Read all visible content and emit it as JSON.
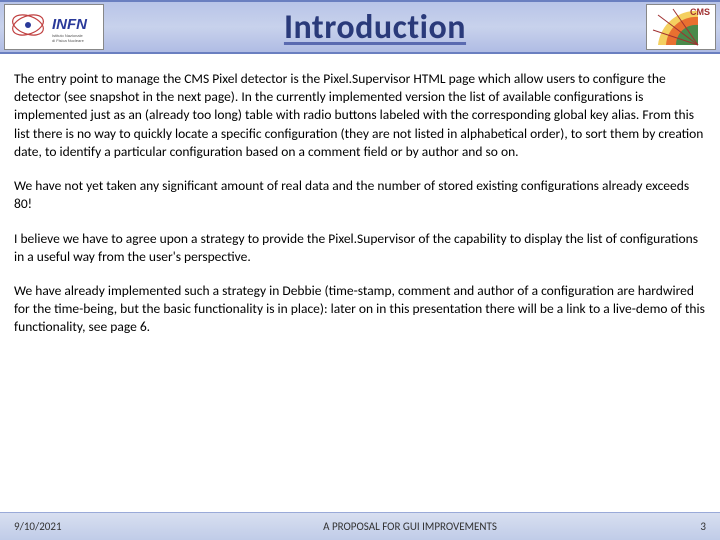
{
  "header": {
    "title": "Introduction",
    "logo_left_text_main": "INFN",
    "logo_left_text_sub": "Istituto Nazionale di Fisica Nucleare",
    "logo_right_text": "CMS"
  },
  "body": {
    "p1": "The entry point to manage the CMS Pixel detector is the Pixel.Supervisor HTML page which allow users to configure the detector (see snapshot in the next page). In the currently implemented version the list of available configurations is implemented just as an (already too long) table with radio buttons labeled with the corresponding global key alias. From this list there is no way to quickly locate a specific configuration (they are not listed in alphabetical order), to sort them by creation date, to identify a particular configuration based on a comment field or by author and so on.",
    "p2": "We have not yet taken any significant amount of real data and the number of stored existing configurations already exceeds 80!",
    "p3": "I believe we have to agree upon a strategy to provide the Pixel.Supervisor of the capability to display the list of configurations in a useful way from the user's perspective.",
    "p4": "We have already implemented such a strategy in Debbie (time-stamp, comment and author of a configuration are hardwired for the time-being, but the basic functionality is in place): later on in this presentation there will be a link to a live-demo of this functionality, see page 6."
  },
  "footer": {
    "date": "9/10/2021",
    "title": "A PROPOSAL FOR GUI IMPROVEMENTS",
    "page": "3"
  }
}
